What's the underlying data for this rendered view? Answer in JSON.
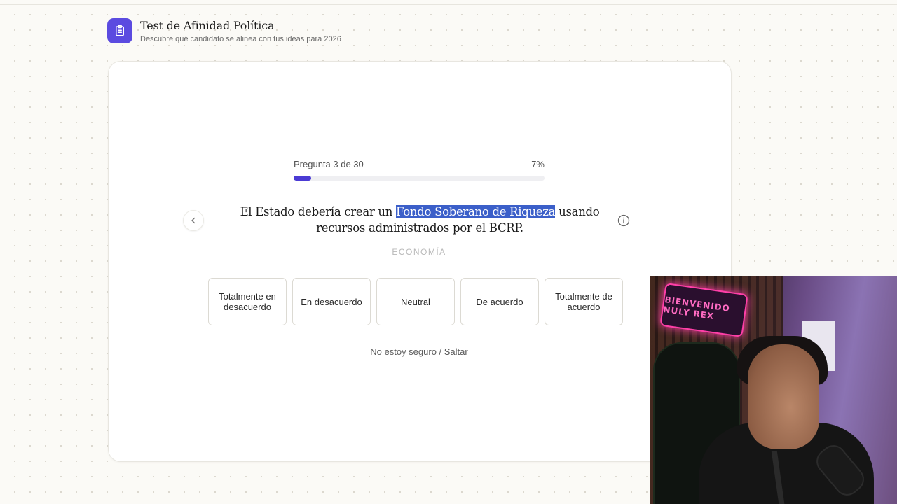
{
  "header": {
    "title": "Test de Afinidad Política",
    "subtitle": "Descubre qué candidato se alinea con tus ideas para 2026",
    "icon": "clipboard-icon",
    "accent": "#5b4be0"
  },
  "progress": {
    "label": "Pregunta 3 de 30",
    "percent_label": "7%",
    "value": 0.07,
    "color": "#4b3bd4"
  },
  "question": {
    "text_before": "El Estado debería crear un ",
    "highlight": "Fondo Soberano de Riqueza",
    "text_after": " usando recursos administrados por el BCRP.",
    "highlight_color": "#3b5fc9",
    "category": "ECONOMÍA"
  },
  "navigation": {
    "prev_icon": "chevron-left-icon",
    "info_icon": "info-icon"
  },
  "options": [
    {
      "label": "Totalmente en desacuerdo"
    },
    {
      "label": "En desacuerdo"
    },
    {
      "label": "Neutral"
    },
    {
      "label": "De acuerdo"
    },
    {
      "label": "Totalmente de acuerdo"
    }
  ],
  "skip_label": "No estoy seguro / Saltar",
  "webcam": {
    "sign_text": "BIENVENIDO NULY REX"
  }
}
